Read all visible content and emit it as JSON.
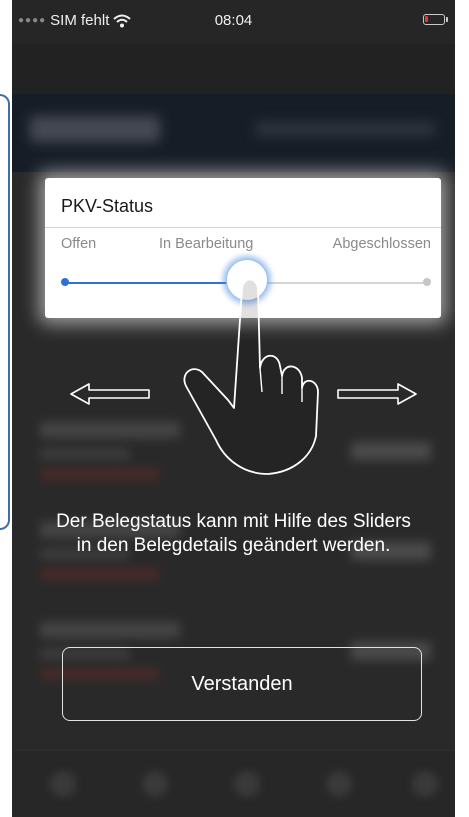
{
  "status_bar": {
    "carrier": "SIM fehlt",
    "time": "08:04",
    "wifi_icon": "wifi-icon",
    "battery_icon": "battery-low-icon",
    "battery_color": "#e53935"
  },
  "status_card": {
    "title": "PKV-Status",
    "stages": [
      "Offen",
      "In Bearbeitung",
      "Abgeschlossen"
    ],
    "current_stage_index": 1,
    "slider_value": 0.5,
    "accent_color": "#2f72d6"
  },
  "gesture": {
    "hand_icon": "hand-pointer-icon",
    "left_arrow_icon": "arrow-left-icon",
    "right_arrow_icon": "arrow-right-icon"
  },
  "hint_text": "Der Belegstatus kann mit Hilfe des Sliders in den Belegdetails geändert werden.",
  "confirm_button": {
    "label": "Verstanden"
  }
}
